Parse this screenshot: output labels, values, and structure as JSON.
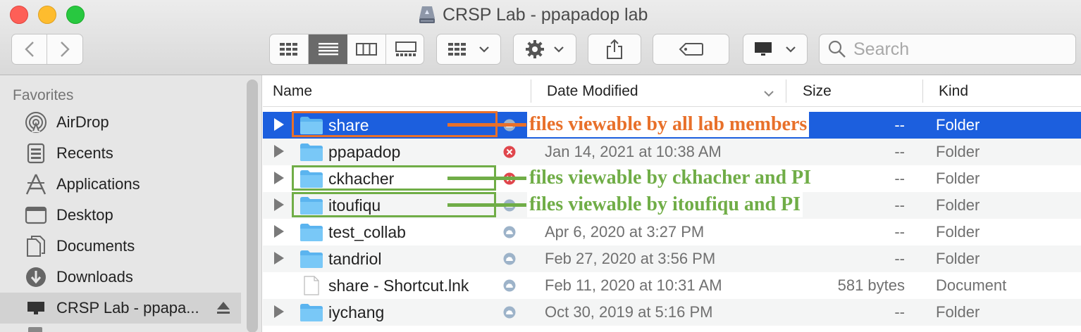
{
  "window": {
    "title": "CRSP Lab - ppapadop lab"
  },
  "toolbar": {
    "search_placeholder": "Search",
    "view_modes": [
      "icon-view",
      "list-view",
      "column-view",
      "gallery-view"
    ],
    "selected_view": "list-view"
  },
  "sidebar": {
    "section_title": "Favorites",
    "items": [
      {
        "label": "AirDrop",
        "icon": "airdrop-icon"
      },
      {
        "label": "Recents",
        "icon": "recents-icon"
      },
      {
        "label": "Applications",
        "icon": "applications-icon"
      },
      {
        "label": "Desktop",
        "icon": "desktop-icon"
      },
      {
        "label": "Documents",
        "icon": "documents-icon"
      },
      {
        "label": "Downloads",
        "icon": "downloads-icon"
      },
      {
        "label": "CRSP Lab - ppapa...",
        "icon": "network-drive-icon",
        "selected": true
      }
    ]
  },
  "columns": {
    "name": "Name",
    "date": "Date Modified",
    "size": "Size",
    "kind": "Kind"
  },
  "files": [
    {
      "name": "share",
      "date": "",
      "size": "--",
      "kind": "Folder",
      "type": "folder",
      "status": "cloud",
      "selected": true
    },
    {
      "name": "ppapadop",
      "date": "Jan 14, 2021 at 10:38 AM",
      "size": "--",
      "kind": "Folder",
      "type": "folder",
      "status": "blocked"
    },
    {
      "name": "ckhacher",
      "date": "",
      "size": "--",
      "kind": "Folder",
      "type": "folder",
      "status": "blocked"
    },
    {
      "name": "itoufiqu",
      "date": "",
      "size": "--",
      "kind": "Folder",
      "type": "folder",
      "status": "cloud"
    },
    {
      "name": "test_collab",
      "date": "Apr 6, 2020 at 3:27 PM",
      "size": "--",
      "kind": "Folder",
      "type": "folder",
      "status": "cloud"
    },
    {
      "name": "tandriol",
      "date": "Feb 27, 2020 at 3:56 PM",
      "size": "--",
      "kind": "Folder",
      "type": "folder",
      "status": "cloud"
    },
    {
      "name": "share - Shortcut.lnk",
      "date": "Feb 11, 2020 at 10:31 AM",
      "size": "581 bytes",
      "kind": "Document",
      "type": "document",
      "status": "cloud"
    },
    {
      "name": "iychang",
      "date": "Oct 30, 2019 at 5:16 PM",
      "size": "--",
      "kind": "Folder",
      "type": "folder",
      "status": "cloud"
    }
  ],
  "annotations": [
    {
      "text": "files viewable by all lab  members",
      "color": "#e8702a"
    },
    {
      "text": "files viewable by ckhacher and PI",
      "color": "#70ad47"
    },
    {
      "text": "files viewable by itoufiqu and PI",
      "color": "#70ad47"
    }
  ],
  "colors": {
    "selection": "#1c5fde",
    "folder": "#6cc0f5",
    "annotation_orange": "#e8702a",
    "annotation_green": "#70ad47"
  }
}
